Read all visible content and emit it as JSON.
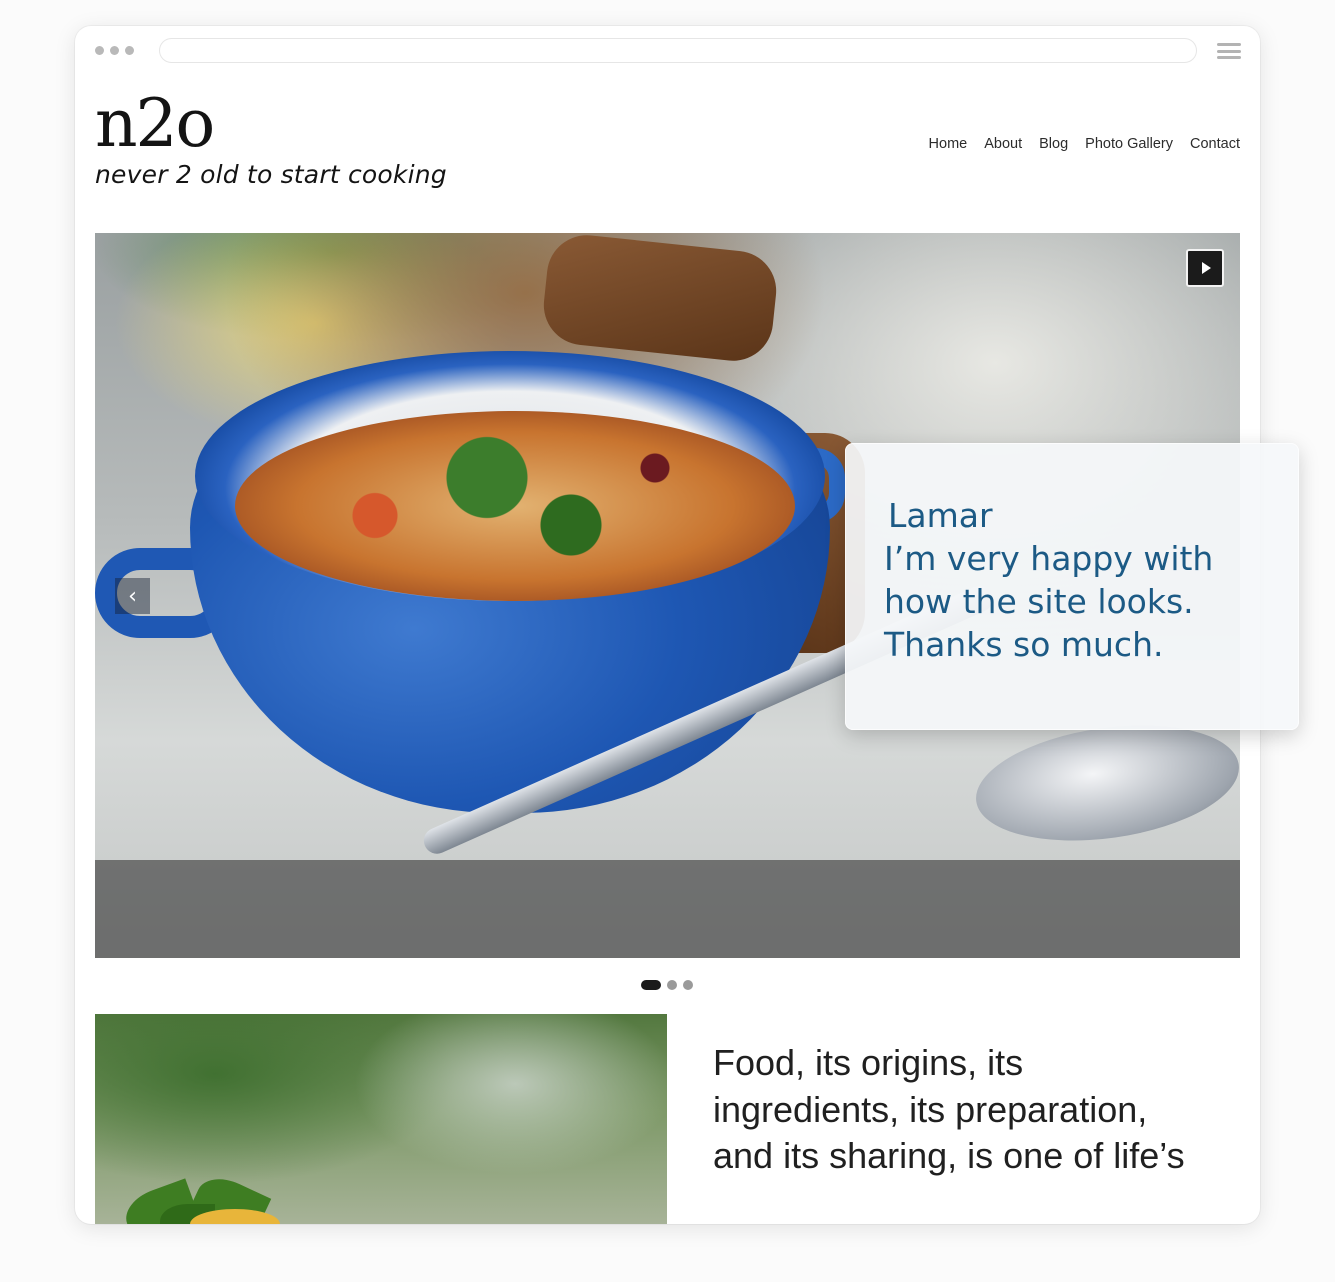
{
  "browser": {
    "window_controls": [
      "dot",
      "dot",
      "dot"
    ],
    "menu_icon": "hamburger-icon"
  },
  "brand": {
    "logo": "n2o",
    "tagline": "never 2 old to start cooking"
  },
  "nav": {
    "items": [
      {
        "label": "Home"
      },
      {
        "label": "About"
      },
      {
        "label": "Blog"
      },
      {
        "label": "Photo Gallery"
      },
      {
        "label": "Contact"
      }
    ]
  },
  "slider": {
    "play_icon": "play-icon",
    "prev_icon": "chevron-left-icon",
    "prev_glyph": "‹",
    "slide_count": 3,
    "active_slide": 1
  },
  "testimonial": {
    "name": "Lamar",
    "quote": "I’m very happy with how the site looks. Thanks so much."
  },
  "feature": {
    "text": "Food, its origins, its ingredients, its preparation, and its sharing, is one of life’s"
  },
  "colors": {
    "testimonial_text": "#1c5a85",
    "nav_text": "#2c2c2c",
    "active_dot": "#1a1a1a"
  }
}
